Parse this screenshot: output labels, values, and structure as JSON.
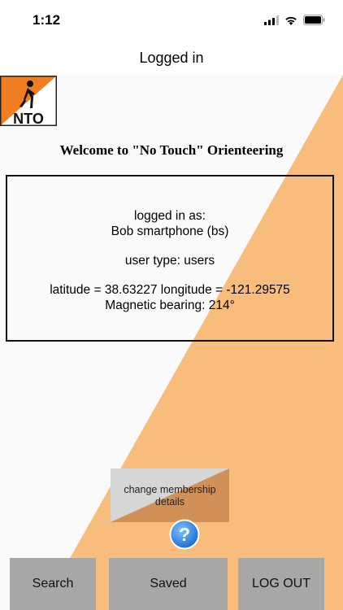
{
  "status_bar": {
    "time": "1:12"
  },
  "nav": {
    "title": "Logged in"
  },
  "logo": {
    "text": "NTO"
  },
  "welcome": "Welcome to \"No Touch\" Orienteering",
  "info": {
    "logged_in_as_label": "logged in as:",
    "user_name": "Bob smartphone (bs)",
    "user_type": "user type: users",
    "coordinates": "latitude = 38.63227 longitude = -121.29575",
    "bearing": "Magnetic bearing: 214°"
  },
  "buttons": {
    "membership_line1": "change membership",
    "membership_line2": "details",
    "search": "Search",
    "saved": "Saved",
    "logout": "LOG OUT"
  },
  "colors": {
    "accent_orange": "#f8bc7d",
    "logo_orange": "#f07d22",
    "button_gray": "#a7a7a7",
    "help_blue": "#3a8fe0"
  }
}
